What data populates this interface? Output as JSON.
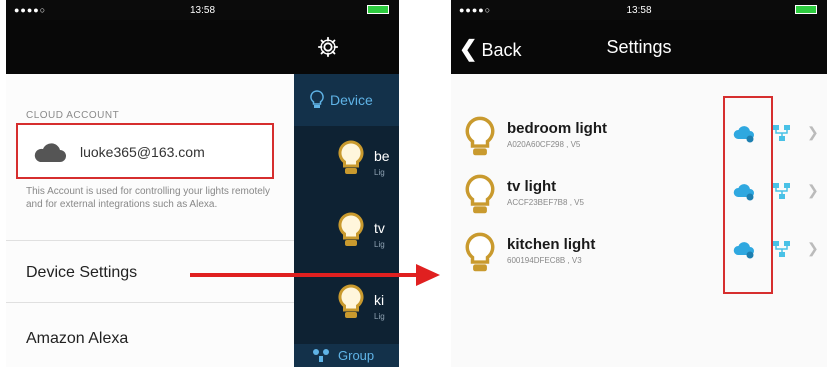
{
  "left_screen": {
    "status": {
      "signal": "●●●●○",
      "time": "13:58",
      "battery": ""
    },
    "section_label": "CLOUD ACCOUNT",
    "account_email": "luoke365@163.com",
    "account_description": "This Account is used for controlling your lights remotely and for external integrations such as Alexa.",
    "menu": {
      "device_settings": "Device Settings",
      "amazon_alexa": "Amazon Alexa"
    },
    "sidebar": {
      "header": "Device",
      "items": [
        {
          "name_cut": "be",
          "sub_cut": "Lig"
        },
        {
          "name_cut": "tv",
          "sub_cut": "Lig"
        },
        {
          "name_cut": "ki",
          "sub_cut": "Lig"
        }
      ],
      "footer": "Group"
    }
  },
  "right_screen": {
    "status": {
      "signal": "●●●●○",
      "time": "13:58",
      "battery": ""
    },
    "back_label": "Back",
    "title": "Settings",
    "devices": [
      {
        "name": "bedroom light",
        "meta": "A020A60CF298 , V5"
      },
      {
        "name": "tv light",
        "meta": "ACCF23BEF7B8 , V5"
      },
      {
        "name": "kitchen light",
        "meta": "600194DFEC8B , V3"
      }
    ]
  },
  "colors": {
    "highlight": "#d62e2e",
    "accent_blue": "#2fa8e0",
    "bulb": "#c99a2e",
    "sidebar": "#0e2233"
  },
  "icons": [
    "gear-icon",
    "cloud-icon",
    "bulb-icon",
    "chevron-left-icon",
    "cloud-upload-icon",
    "network-icon",
    "chevron-right-icon",
    "arrow-right-icon"
  ]
}
